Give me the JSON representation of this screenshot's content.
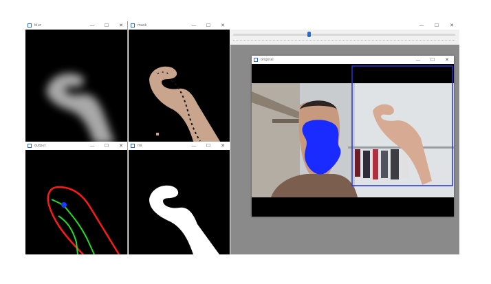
{
  "windows": {
    "blur": {
      "title": "blur",
      "controls": [
        "—",
        "☐",
        "✕"
      ]
    },
    "mask": {
      "title": "mask",
      "controls": [
        "—",
        "☐",
        "✕"
      ]
    },
    "output": {
      "title": "output",
      "controls": [
        "—",
        "☐",
        "✕"
      ]
    },
    "roi": {
      "title": "roi",
      "controls": [
        "—",
        "☐",
        "✕"
      ]
    },
    "trackbar": {
      "title": "",
      "controls": [
        "—",
        "☐",
        "✕"
      ]
    },
    "original": {
      "title": "original",
      "controls": [
        "—",
        "☐",
        "✕"
      ]
    }
  },
  "trackbar": {
    "value_fraction": 0.34
  },
  "icons": {
    "window": "window-app-icon"
  },
  "colors": {
    "contour": "#ff1a1a",
    "hull": "#22dd22",
    "marker": "#1a3cff",
    "roi_box": "#2233dd"
  }
}
